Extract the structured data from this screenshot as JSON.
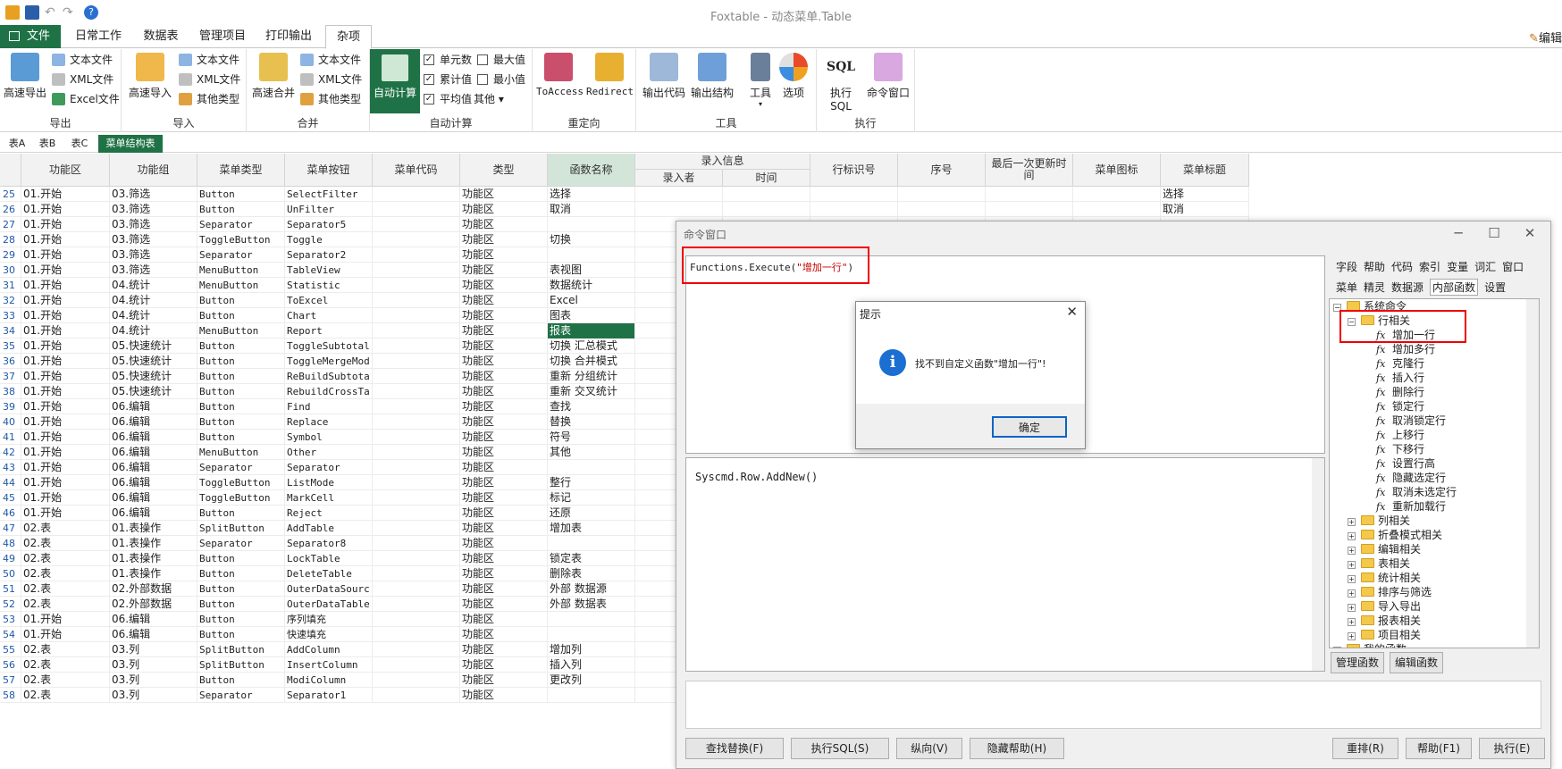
{
  "window": {
    "title": "Foxtable - 动态菜单.Table",
    "edit_label": "编辑"
  },
  "ribbon_tabs": {
    "file": "文件",
    "items": [
      "日常工作",
      "数据表",
      "管理项目",
      "打印输出",
      "杂项"
    ],
    "active": "杂项"
  },
  "ribbon": {
    "export": {
      "big": "高速导出",
      "small": [
        "文本文件",
        "XML文件",
        "Excel文件"
      ],
      "label": "导出"
    },
    "import": {
      "big": "高速导入",
      "small": [
        "文本文件",
        "XML文件",
        "其他类型"
      ],
      "label": "导入"
    },
    "merge": {
      "big": "高速合并",
      "small": [
        "文本文件",
        "XML文件",
        "其他类型"
      ],
      "label": "合并"
    },
    "autocalc": {
      "big": "自动计算",
      "checks": [
        {
          "label": "单元数",
          "checked": true
        },
        {
          "label": "累计值",
          "checked": true
        },
        {
          "label": "平均值",
          "checked": true
        },
        {
          "label": "最大值",
          "checked": false
        },
        {
          "label": "最小值",
          "checked": false
        }
      ],
      "other": "其他",
      "label": "自动计算"
    },
    "redirect": {
      "buttons": [
        "ToAccess",
        "Redirect"
      ],
      "label": "重定向"
    },
    "tools": {
      "buttons": [
        "输出代码",
        "输出结构",
        "工具",
        "选项"
      ],
      "label": "工具"
    },
    "exec": {
      "buttons": [
        "执行SQL",
        "命令窗口"
      ],
      "label": "执行"
    }
  },
  "sheet_tabs": [
    "表A",
    "表B",
    "表C",
    "菜单结构表"
  ],
  "grid": {
    "headers": [
      "功能区",
      "功能组",
      "菜单类型",
      "菜单按钮",
      "菜单代码",
      "类型",
      "函数名称",
      "录入信息",
      "行标识号",
      "序号",
      "最后一次更新时间",
      "菜单图标",
      "菜单标题"
    ],
    "sub_headers": [
      "录入者",
      "时间"
    ],
    "rows": [
      [
        "25",
        "01.开始",
        "03.筛选",
        "Button",
        "SelectFilter",
        "",
        "功能区",
        "选择",
        "选择"
      ],
      [
        "26",
        "01.开始",
        "03.筛选",
        "Button",
        "UnFilter",
        "",
        "功能区",
        "取消",
        "取消"
      ],
      [
        "27",
        "01.开始",
        "03.筛选",
        "Separator",
        "Separator5",
        "",
        "功能区",
        "",
        ""
      ],
      [
        "28",
        "01.开始",
        "03.筛选",
        "ToggleButton",
        "Toggle",
        "",
        "功能区",
        "切换",
        ""
      ],
      [
        "29",
        "01.开始",
        "03.筛选",
        "Separator",
        "Separator2",
        "",
        "功能区",
        "",
        ""
      ],
      [
        "30",
        "01.开始",
        "03.筛选",
        "MenuButton",
        "TableView",
        "",
        "功能区",
        "表视图",
        ""
      ],
      [
        "31",
        "01.开始",
        "04.统计",
        "MenuButton",
        "Statistic",
        "",
        "功能区",
        "数据统计",
        ""
      ],
      [
        "32",
        "01.开始",
        "04.统计",
        "Button",
        "ToExcel",
        "",
        "功能区",
        "Excel",
        ""
      ],
      [
        "33",
        "01.开始",
        "04.统计",
        "Button",
        "Chart",
        "",
        "功能区",
        "图表",
        ""
      ],
      [
        "34",
        "01.开始",
        "04.统计",
        "MenuButton",
        "Report",
        "",
        "功能区",
        "报表",
        ""
      ],
      [
        "35",
        "01.开始",
        "05.快速统计",
        "Button",
        "ToggleSubtotal",
        "",
        "功能区",
        "切换 汇总模式",
        ""
      ],
      [
        "36",
        "01.开始",
        "05.快速统计",
        "Button",
        "ToggleMergeMod",
        "",
        "功能区",
        "切换 合并模式",
        ""
      ],
      [
        "37",
        "01.开始",
        "05.快速统计",
        "Button",
        "ReBuildSubtota",
        "",
        "功能区",
        "重新 分组统计",
        ""
      ],
      [
        "38",
        "01.开始",
        "05.快速统计",
        "Button",
        "RebuildCrossTa",
        "",
        "功能区",
        "重新 交叉统计",
        ""
      ],
      [
        "39",
        "01.开始",
        "06.编辑",
        "Button",
        "Find",
        "",
        "功能区",
        "查找",
        ""
      ],
      [
        "40",
        "01.开始",
        "06.编辑",
        "Button",
        "Replace",
        "",
        "功能区",
        "替换",
        ""
      ],
      [
        "41",
        "01.开始",
        "06.编辑",
        "Button",
        "Symbol",
        "",
        "功能区",
        "符号",
        ""
      ],
      [
        "42",
        "01.开始",
        "06.编辑",
        "MenuButton",
        "Other",
        "",
        "功能区",
        "其他",
        ""
      ],
      [
        "43",
        "01.开始",
        "06.编辑",
        "Separator",
        "Separator",
        "",
        "功能区",
        "",
        ""
      ],
      [
        "44",
        "01.开始",
        "06.编辑",
        "ToggleButton",
        "ListMode",
        "",
        "功能区",
        "整行",
        ""
      ],
      [
        "45",
        "01.开始",
        "06.编辑",
        "ToggleButton",
        "MarkCell",
        "",
        "功能区",
        "标记",
        ""
      ],
      [
        "46",
        "01.开始",
        "06.编辑",
        "Button",
        "Reject",
        "",
        "功能区",
        "还原",
        ""
      ],
      [
        "47",
        "02.表",
        "01.表操作",
        "SplitButton",
        "AddTable",
        "",
        "功能区",
        "增加表",
        ""
      ],
      [
        "48",
        "02.表",
        "01.表操作",
        "Separator",
        "Separator8",
        "",
        "功能区",
        "",
        ""
      ],
      [
        "49",
        "02.表",
        "01.表操作",
        "Button",
        "LockTable",
        "",
        "功能区",
        "锁定表",
        ""
      ],
      [
        "50",
        "02.表",
        "01.表操作",
        "Button",
        "DeleteTable",
        "",
        "功能区",
        "删除表",
        ""
      ],
      [
        "51",
        "02.表",
        "02.外部数据",
        "Button",
        "OuterDataSourc",
        "",
        "功能区",
        "外部 数据源",
        ""
      ],
      [
        "52",
        "02.表",
        "02.外部数据",
        "Button",
        "OuterDataTable",
        "",
        "功能区",
        "外部 数据表",
        ""
      ],
      [
        "53",
        "01.开始",
        "06.编辑",
        "Button",
        "序列填充",
        "",
        "功能区",
        "",
        ""
      ],
      [
        "54",
        "01.开始",
        "06.编辑",
        "Button",
        "快速填充",
        "",
        "功能区",
        "",
        ""
      ],
      [
        "55",
        "02.表",
        "03.列",
        "SplitButton",
        "AddColumn",
        "",
        "功能区",
        "增加列",
        ""
      ],
      [
        "56",
        "02.表",
        "03.列",
        "SplitButton",
        "InsertColumn",
        "",
        "功能区",
        "插入列",
        ""
      ],
      [
        "57",
        "02.表",
        "03.列",
        "Button",
        "ModiColumn",
        "",
        "功能区",
        "更改列",
        ""
      ],
      [
        "58",
        "02.表",
        "03.列",
        "Separator",
        "Separator1",
        "",
        "功能区",
        "",
        ""
      ]
    ],
    "selected_cell": "报表"
  },
  "command_window": {
    "title": "命令窗口",
    "code1_prefix": "Functions.Execute(",
    "code1_string": "\"增加一行\"",
    "code1_suffix": ")",
    "code2": "Syscmd.Row.AddNew()",
    "right_tabs_row1": [
      "字段",
      "帮助",
      "代码",
      "索引",
      "变量",
      "词汇",
      "窗口"
    ],
    "right_tabs_row2": [
      "菜单",
      "精灵",
      "数据源",
      "内部函数",
      "设置"
    ],
    "active_tab": "内部函数",
    "tree": {
      "root": "系统命令",
      "group": "行相关",
      "items": [
        "增加一行",
        "增加多行",
        "克隆行",
        "插入行",
        "删除行",
        "锁定行",
        "取消锁定行",
        "上移行",
        "下移行",
        "设置行高",
        "隐藏选定行",
        "取消未选定行",
        "重新加载行"
      ],
      "groups": [
        "列相关",
        "折叠模式相关",
        "编辑相关",
        "表相关",
        "统计相关",
        "排序与筛选",
        "导入导出",
        "报表相关",
        "项目相关"
      ],
      "last": "我的函数"
    },
    "tree_buttons": [
      "管理函数",
      "编辑函数"
    ],
    "bottom_buttons_left": [
      "查找替换(F)",
      "执行SQL(S)",
      "纵向(V)",
      "隐藏帮助(H)"
    ],
    "bottom_buttons_right": [
      "重排(R)",
      "帮助(F1)",
      "执行(E)"
    ]
  },
  "dialog": {
    "title": "提示",
    "message": "找不到自定义函数\"增加一行\"!",
    "ok": "确定"
  }
}
